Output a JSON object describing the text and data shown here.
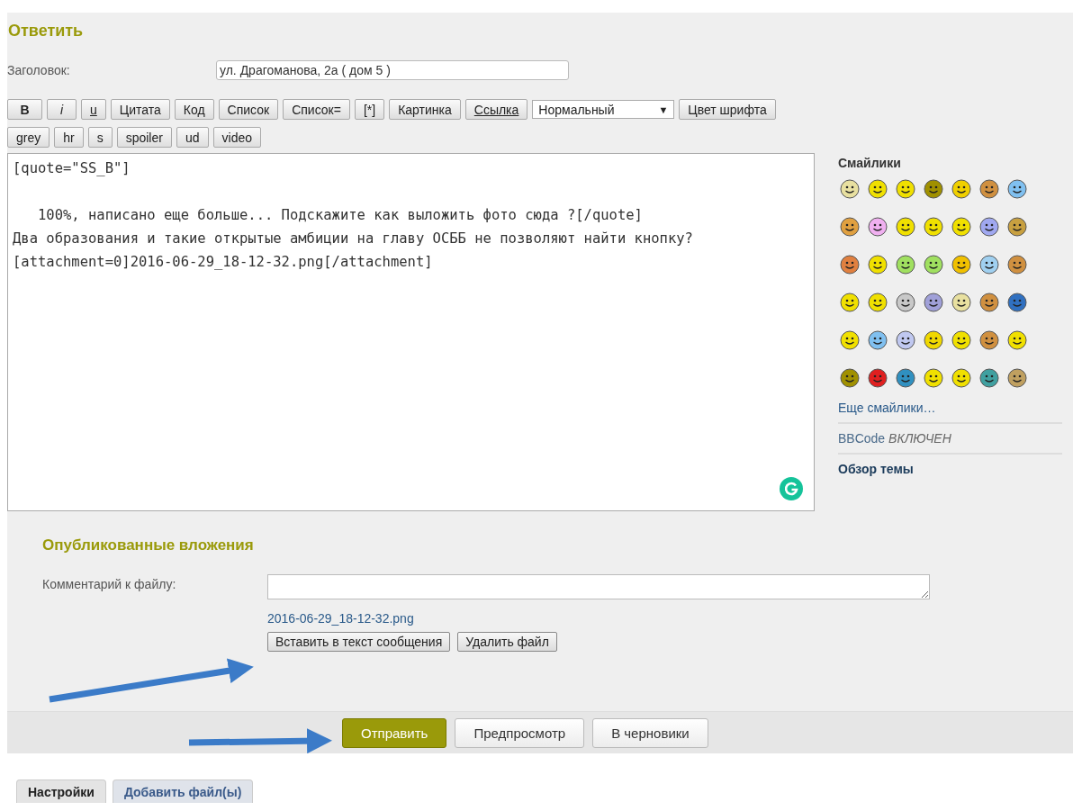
{
  "reply": {
    "heading": "Ответить",
    "subject": {
      "label": "Заголовок:",
      "value": "ул. Драгоманова, 2а ( дом 5 )"
    },
    "toolbar_row_1": [
      {
        "label": "B",
        "kind": "bold"
      },
      {
        "label": "i",
        "kind": "italic"
      },
      {
        "label": "u",
        "kind": "underline"
      },
      {
        "label": "Цитата",
        "kind": "plain"
      },
      {
        "label": "Код",
        "kind": "plain"
      },
      {
        "label": "Список",
        "kind": "plain"
      },
      {
        "label": "Список=",
        "kind": "plain"
      },
      {
        "label": "[*]",
        "kind": "plain"
      },
      {
        "label": "Картинка",
        "kind": "plain"
      },
      {
        "label": "Ссылка",
        "kind": "underline"
      }
    ],
    "font_size_select": {
      "value": "Нормальный",
      "arrow": "▼"
    },
    "font_color_button": "Цвет шрифта",
    "toolbar_row_2": [
      {
        "label": "grey"
      },
      {
        "label": "hr"
      },
      {
        "label": "s"
      },
      {
        "label": "spoiler"
      },
      {
        "label": "ud"
      },
      {
        "label": "video"
      }
    ],
    "message": "[quote=\"SS_B\"]\n\n   100%, написано еще больше... Подскажите как выложить фото сюда ?[/quote]\nДва образования и такие открытые амбиции на главу ОСББ не позволяют найти кнопку?\n[attachment=0]2016-06-29_18-12-32.png[/attachment]",
    "sidebar": {
      "smilies_title": "Смайлики",
      "smilies": [
        {
          "color": "#e8e0a0"
        },
        {
          "color": "#f0e000"
        },
        {
          "color": "#f0e000"
        },
        {
          "color": "#a09000"
        },
        {
          "color": "#f0d000"
        },
        {
          "color": "#d09040"
        },
        {
          "color": "#80c0f0"
        },
        {
          "color": "#e0a040"
        },
        {
          "color": "#f0b0f0"
        },
        {
          "color": "#f0e000"
        },
        {
          "color": "#f0e000"
        },
        {
          "color": "#f0e000"
        },
        {
          "color": "#a0a8f0"
        },
        {
          "color": "#c8a040"
        },
        {
          "color": "#e08040"
        },
        {
          "color": "#f0e000"
        },
        {
          "color": "#a0e060"
        },
        {
          "color": "#a0e060"
        },
        {
          "color": "#f0c000"
        },
        {
          "color": "#a0d0f0"
        },
        {
          "color": "#d09040"
        },
        {
          "color": "#f0e000"
        },
        {
          "color": "#f0e000"
        },
        {
          "color": "#c8c8c8"
        },
        {
          "color": "#a0a0d8"
        },
        {
          "color": "#e8e0a0"
        },
        {
          "color": "#d09040"
        },
        {
          "color": "#3070c0"
        },
        {
          "color": "#f0e000"
        },
        {
          "color": "#80c0f0"
        },
        {
          "color": "#c0c8f0"
        },
        {
          "color": "#f0d800"
        },
        {
          "color": "#f0e000"
        },
        {
          "color": "#d09040"
        },
        {
          "color": "#f0e000"
        },
        {
          "color": "#a09000"
        },
        {
          "color": "#e02020"
        },
        {
          "color": "#3090c0"
        },
        {
          "color": "#f0e000"
        },
        {
          "color": "#f0e000"
        },
        {
          "color": "#40a0a0"
        },
        {
          "color": "#c0a060"
        }
      ],
      "more_smilies": "Еще смайлики…",
      "bbcode_label": "BBCode",
      "bbcode_state": "ВКЛЮЧЕН",
      "topic_review": "Обзор темы"
    }
  },
  "attachments": {
    "heading": "Опубликованные вложения",
    "comment_label": "Комментарий к файлу:",
    "file_name": "2016-06-29_18-12-32.png",
    "buttons": [
      "Вставить в текст сообщения",
      "Удалить файл"
    ]
  },
  "submit_bar": {
    "buttons": [
      {
        "label": "Отправить",
        "primary": true
      },
      {
        "label": "Предпросмотр",
        "primary": false
      },
      {
        "label": "В черновики",
        "primary": false
      }
    ]
  },
  "bottom_tabs": [
    {
      "label": "Настройки",
      "selected": true
    },
    {
      "label": "Добавить файл(ы)",
      "selected": false
    }
  ]
}
